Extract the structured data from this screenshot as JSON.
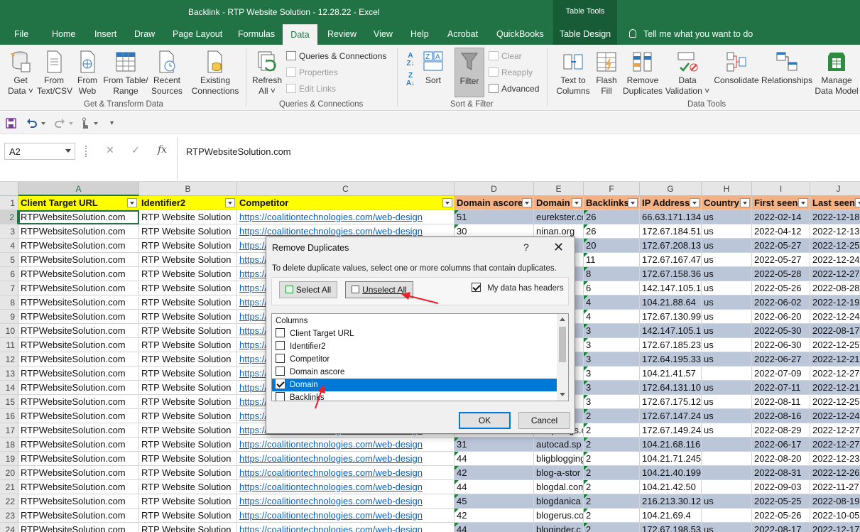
{
  "window": {
    "title": "Backlink  -  RTP Website Solution - 12.28.22  -  Excel",
    "context_group": "Table Tools"
  },
  "tabs": [
    "File",
    "Home",
    "Insert",
    "Draw",
    "Page Layout",
    "Formulas",
    "Data",
    "Review",
    "View",
    "Help",
    "Acrobat",
    "QuickBooks",
    "Table Design"
  ],
  "active_tab": "Data",
  "tell_me": "Tell me what you want to do",
  "ribbon": {
    "get_transform": {
      "label": "Get & Transform Data",
      "get_data": [
        "Get",
        "Data ˅"
      ],
      "from_text": [
        "From",
        "Text/CSV"
      ],
      "from_web": [
        "From",
        "Web"
      ],
      "from_table": [
        "From Table/",
        "Range"
      ],
      "recent": [
        "Recent",
        "Sources"
      ],
      "existing": [
        "Existing",
        "Connections"
      ]
    },
    "queries": {
      "label": "Queries & Connections",
      "refresh": [
        "Refresh",
        "All ˅"
      ],
      "qc": "Queries & Connections",
      "properties": "Properties",
      "edit_links": "Edit Links"
    },
    "sort_filter": {
      "label": "Sort & Filter",
      "sort": "Sort",
      "filter": "Filter",
      "clear": "Clear",
      "reapply": "Reapply",
      "advanced": "Advanced"
    },
    "data_tools": {
      "label": "Data Tools",
      "text_to_columns": [
        "Text to",
        "Columns"
      ],
      "flash_fill": [
        "Flash",
        "Fill"
      ],
      "remove_duplicates": [
        "Remove",
        "Duplicates"
      ],
      "data_validation": [
        "Data",
        "Validation ˅"
      ],
      "consolidate": "Consolidate",
      "relationships": "Relationships",
      "manage_model": [
        "Manage",
        "Data Model"
      ]
    }
  },
  "formula_bar": {
    "name_box": "A2",
    "fx": "fx",
    "content": "RTPWebsiteSolution.com"
  },
  "grid": {
    "columns": [
      "A",
      "B",
      "C",
      "D",
      "E",
      "F",
      "G",
      "H",
      "I",
      "J"
    ],
    "headers": [
      "Client Target URL",
      "Identifier2",
      "Competitor",
      "Domain ascore",
      "Domain",
      "Backlinks",
      "IP Address",
      "Country",
      "First seen",
      "Last seen"
    ],
    "rows": [
      [
        "RTPWebsiteSolution.com",
        "RTP Website Solution",
        "https://coalitiontechnologies.com/web-design",
        "51",
        "eurekster.com",
        "26",
        "66.63.171.134",
        "us",
        "2022-02-14",
        "2022-12-18"
      ],
      [
        "RTPWebsiteSolution.com",
        "RTP Website Solution",
        "https://coalitiontechnologies.com/web-design",
        "30",
        "ninan.org",
        "26",
        "172.67.184.51",
        "us",
        "2022-04-12",
        "2022-12-13"
      ],
      [
        "RTPWebsiteSolution.com",
        "RTP Website Solution",
        "https://coalitiontechnologies.com/web-design",
        "",
        "...logi",
        "20",
        "172.67.208.139",
        "us",
        "2022-05-27",
        "2022-12-25"
      ],
      [
        "RTPWebsiteSolution.com",
        "RTP Website Solution",
        "https://coalitiontechnologies.com/web-design",
        "",
        "...",
        "11",
        "172.67.167.47",
        "us",
        "2022-05-27",
        "2022-12-24"
      ],
      [
        "RTPWebsiteSolution.com",
        "RTP Website Solution",
        "https://coalitiontechnologies.com/web-design",
        "",
        "...d.c",
        "8",
        "172.67.158.36",
        "us",
        "2022-05-28",
        "2022-12-27"
      ],
      [
        "RTPWebsiteSolution.com",
        "RTP Website Solution",
        "https://coalitiontechnologies.com/web-design",
        "",
        "...log",
        "6",
        "142.147.105.19",
        "us",
        "2022-05-26",
        "2022-08-28"
      ],
      [
        "RTPWebsiteSolution.com",
        "RTP Website Solution",
        "https://coalitiontechnologies.com/web-design",
        "",
        "...l.c",
        "4",
        "104.21.88.64",
        "us",
        "2022-06-02",
        "2022-12-19"
      ],
      [
        "RTPWebsiteSolution.com",
        "RTP Website Solution",
        "https://coalitiontechnologies.com/web-design",
        "",
        "...og",
        "4",
        "172.67.130.99",
        "us",
        "2022-06-20",
        "2022-12-24"
      ],
      [
        "RTPWebsiteSolution.com",
        "RTP Website Solution",
        "https://coalitiontechnologies.com/web-design",
        "",
        "...na",
        "3",
        "142.147.105.19",
        "us",
        "2022-05-30",
        "2022-08-17"
      ],
      [
        "RTPWebsiteSolution.com",
        "RTP Website Solution",
        "https://coalitiontechnologies.com/web-design",
        "",
        "...g.",
        "3",
        "172.67.185.234",
        "us",
        "2022-06-30",
        "2022-12-25"
      ],
      [
        "RTPWebsiteSolution.com",
        "RTP Website Solution",
        "https://coalitiontechnologies.com/web-design",
        "",
        "...tio",
        "3",
        "172.64.195.33",
        "us",
        "2022-06-27",
        "2022-12-21"
      ],
      [
        "RTPWebsiteSolution.com",
        "RTP Website Solution",
        "https://coalitiontechnologies.com/web-design",
        "",
        "...et",
        "3",
        "104.21.41.57",
        "",
        "2022-07-09",
        "2022-12-27"
      ],
      [
        "RTPWebsiteSolution.com",
        "RTP Website Solution",
        "https://coalitiontechnologies.com/web-design",
        "",
        "...ici",
        "3",
        "172.64.131.10",
        "us",
        "2022-07-11",
        "2022-12-21"
      ],
      [
        "RTPWebsiteSolution.com",
        "RTP Website Solution",
        "https://coalitiontechnologies.com/web-design",
        "",
        "...g.r",
        "3",
        "172.67.175.12",
        "us",
        "2022-08-11",
        "2022-12-25"
      ],
      [
        "RTPWebsiteSolution.com",
        "RTP Website Solution",
        "https://coalitiontechnologies.com/web-design",
        "",
        "...c",
        "2",
        "172.67.147.24",
        "us",
        "2022-08-16",
        "2022-12-24"
      ],
      [
        "RTPWebsiteSolution.com",
        "RTP Website Solution",
        "https://coalitiontechnologies.com/web-design",
        "",
        "...mpblogs.c",
        "2",
        "172.67.149.245",
        "us",
        "2022-08-29",
        "2022-12-27"
      ],
      [
        "RTPWebsiteSolution.com",
        "RTP Website Solution",
        "https://coalitiontechnologies.com/web-design",
        "31",
        "autocad.sp",
        "2",
        "104.21.68.116",
        "",
        "2022-06-17",
        "2022-12-27"
      ],
      [
        "RTPWebsiteSolution.com",
        "RTP Website Solution",
        "https://coalitiontechnologies.com/web-design",
        "44",
        "bligblogging",
        "2",
        "104.21.71.245",
        "",
        "2022-08-20",
        "2022-12-23"
      ],
      [
        "RTPWebsiteSolution.com",
        "RTP Website Solution",
        "https://coalitiontechnologies.com/web-design",
        "42",
        "blog-a-stor",
        "2",
        "104.21.40.199",
        "",
        "2022-08-31",
        "2022-12-26"
      ],
      [
        "RTPWebsiteSolution.com",
        "RTP Website Solution",
        "https://coalitiontechnologies.com/web-design",
        "44",
        "blogdal.com",
        "2",
        "104.21.42.50",
        "",
        "2022-09-03",
        "2022-11-27"
      ],
      [
        "RTPWebsiteSolution.com",
        "RTP Website Solution",
        "https://coalitiontechnologies.com/web-design",
        "45",
        "blogdanica",
        "2",
        "216.213.30.12",
        "us",
        "2022-05-25",
        "2022-08-19"
      ],
      [
        "RTPWebsiteSolution.com",
        "RTP Website Solution",
        "https://coalitiontechnologies.com/web-design",
        "42",
        "blogerus.co",
        "2",
        "104.21.69.4",
        "",
        "2022-05-26",
        "2022-10-05"
      ],
      [
        "RTPWebsiteSolution.com",
        "RTP Website Solution",
        "https://coalitiontechnologies.com/web-design",
        "44",
        "bloginder.c",
        "2",
        "172.67.198.53",
        "us",
        "2022-08-17",
        "2022-12-17"
      ]
    ]
  },
  "dialog": {
    "title": "Remove Duplicates",
    "help": "?",
    "close": "✕",
    "description": "To delete duplicate values, select one or more columns that contain duplicates.",
    "select_all": "Select All",
    "unselect_all": "Unselect All",
    "has_headers": "My data has headers",
    "columns_header": "Columns",
    "columns": [
      {
        "label": "Client Target URL",
        "checked": false
      },
      {
        "label": "Identifier2",
        "checked": false
      },
      {
        "label": "Competitor",
        "checked": false
      },
      {
        "label": "Domain ascore",
        "checked": false
      },
      {
        "label": "Domain",
        "checked": true
      },
      {
        "label": "Backlinks",
        "checked": false
      }
    ],
    "ok": "OK",
    "cancel": "Cancel"
  },
  "colors": {
    "excel_green": "#217346",
    "header_yellow": "#ffff00",
    "header_orange": "#f4b183",
    "row_band": "#bcc6d9",
    "selection_blue": "#0078d7",
    "arrow_red": "#e8202a"
  }
}
